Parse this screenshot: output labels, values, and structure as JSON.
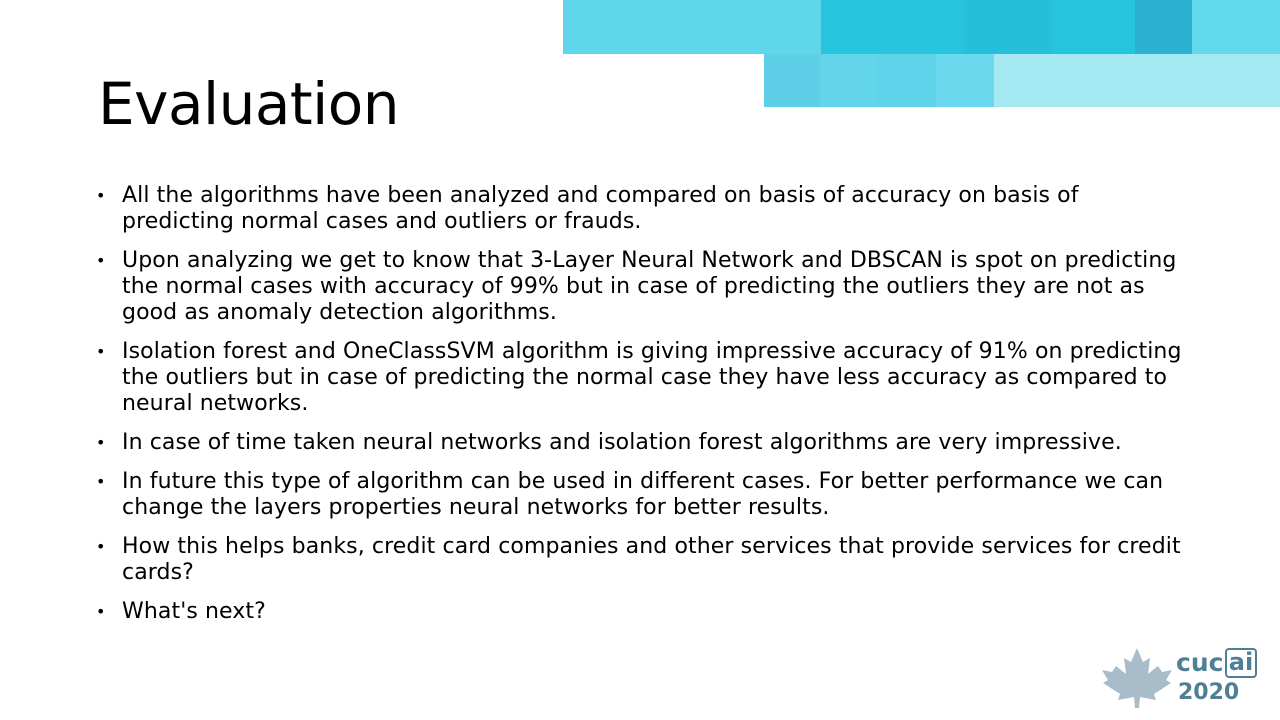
{
  "slide": {
    "title": "Evaluation",
    "bullets": [
      "All the algorithms have been analyzed and compared on basis of accuracy on basis of predicting normal cases and outliers or frauds.",
      "Upon analyzing we get to know that 3-Layer Neural Network and DBSCAN is spot on predicting the normal cases with accuracy of 99% but in case of predicting the outliers they are not as good as anomaly detection algorithms.",
      "Isolation forest and OneClassSVM algorithm is giving impressive accuracy of 91% on predicting the outliers but in case of predicting the normal case they have less accuracy as compared to neural networks.",
      "In case of time taken neural networks and isolation forest algorithms are very impressive.",
      "In future this type of algorithm can be used in different cases. For better performance we can change the layers properties neural networks for better results.",
      "How this helps banks, credit card companies and other services that provide services for credit cards?",
      "What's next?"
    ],
    "bullet_glyph": "•"
  },
  "logo": {
    "cuc": "cuc",
    "ai": "ai",
    "year": "2020",
    "icon": "maple-leaf-icon"
  },
  "colors": {
    "banner_light": "#5fd6ea",
    "banner_mid": "#26c0dc",
    "banner_dark": "#2bb2d2",
    "banner_pale": "#a4e8f2",
    "logo": "#4f7f96",
    "leaf": "#a8bcc9"
  }
}
